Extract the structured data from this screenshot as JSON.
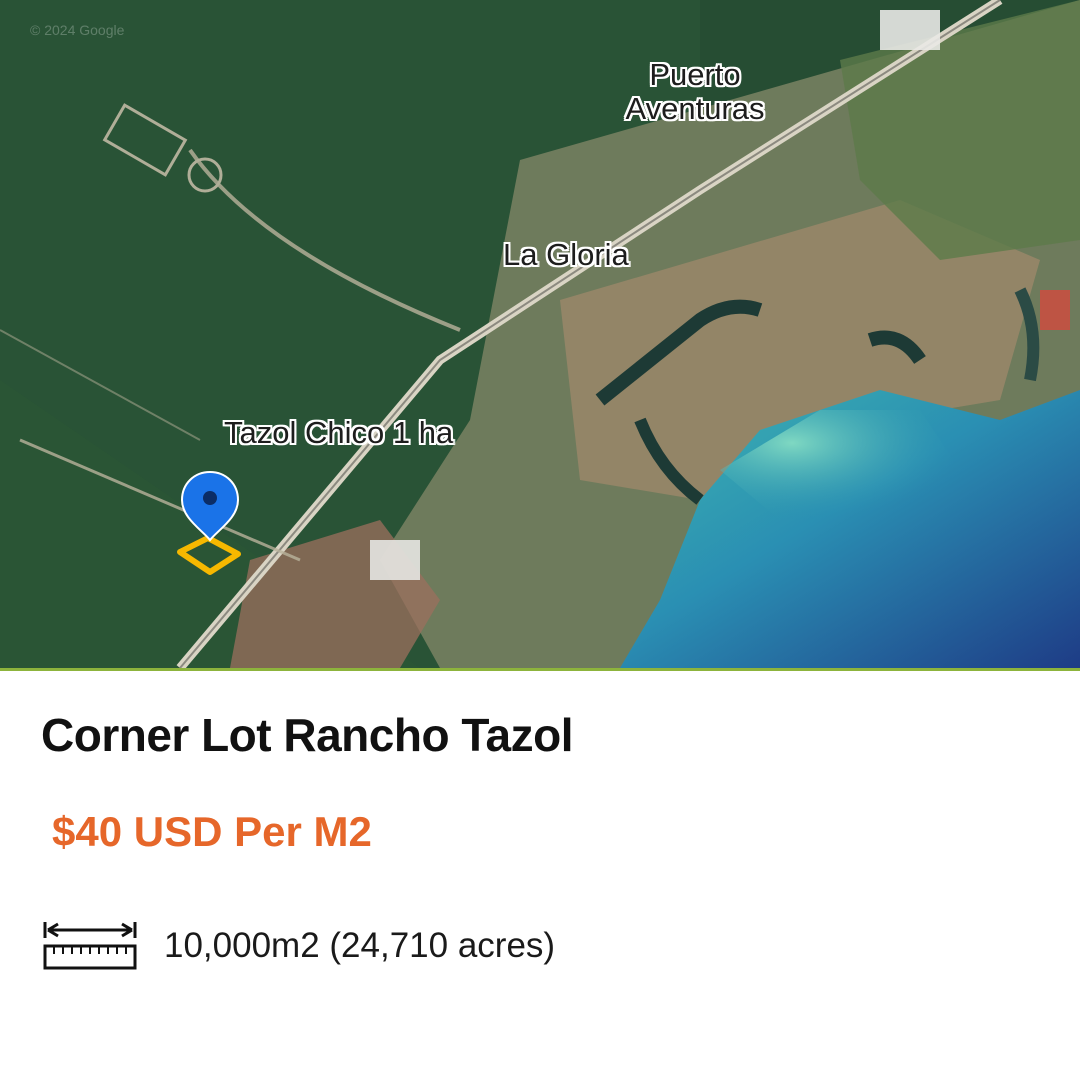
{
  "map": {
    "attribution": "© 2024 Google",
    "labels": {
      "puerto_line1": "Puerto",
      "puerto_line2": "Aventuras",
      "la_gloria": "La Gloria",
      "lot_label": "Tazol Chico 1 ha"
    },
    "pin_color": "#1a73e8",
    "lot_outline_color": "#f6b800",
    "accent_line_color": "#8db43c"
  },
  "listing": {
    "title": "Corner Lot Rancho Tazol",
    "price": "$40 USD Per M2",
    "area_icon": "ruler-measure-icon",
    "area": "10,000m2 (24,710 acres)",
    "price_color": "#e6672a"
  }
}
